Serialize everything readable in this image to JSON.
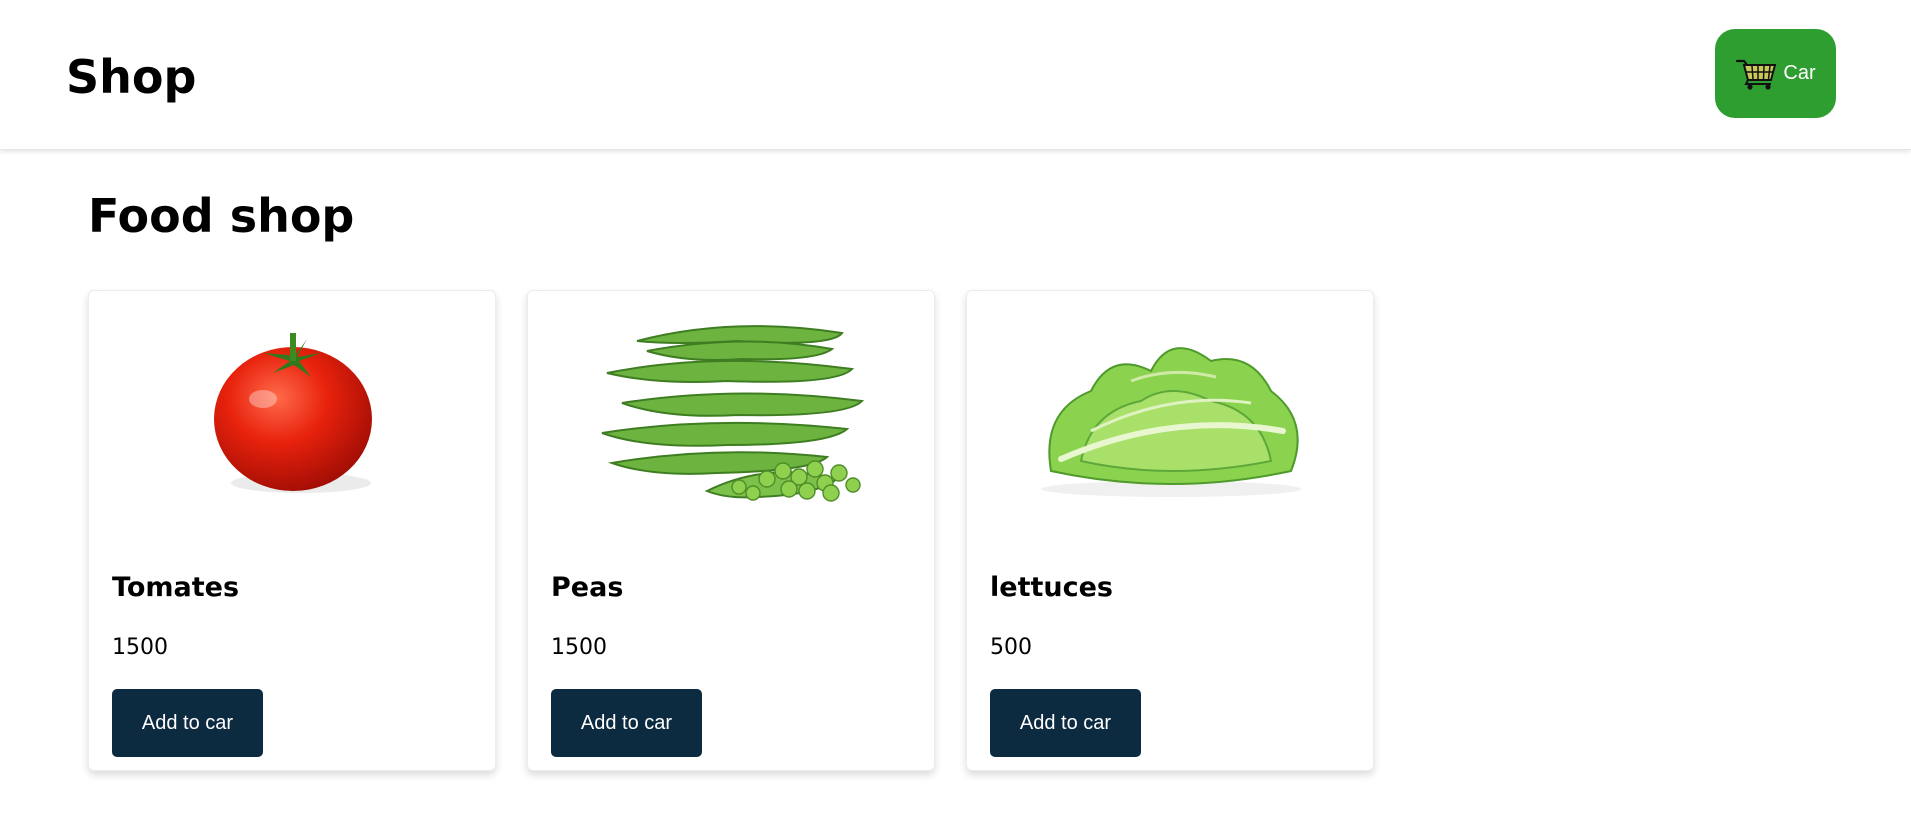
{
  "colors": {
    "accent_green": "#2f9e30",
    "button_dark": "#0c2a40"
  },
  "header": {
    "brand": "Shop",
    "cart": {
      "icon": "shopping-cart-icon",
      "label": "Car"
    }
  },
  "main": {
    "title": "Food shop",
    "products": [
      {
        "name": "Tomates",
        "price": "1500",
        "image": "tomato-image",
        "button_label": "Add to car"
      },
      {
        "name": "Peas",
        "price": "1500",
        "image": "peas-image",
        "button_label": "Add to car"
      },
      {
        "name": "lettuces",
        "price": "500",
        "image": "lettuce-image",
        "button_label": "Add to car"
      }
    ]
  }
}
